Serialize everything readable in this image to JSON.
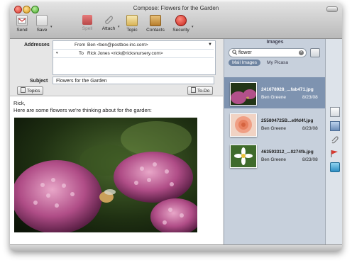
{
  "window": {
    "title": "Compose: Flowers for the Garden"
  },
  "toolbar": {
    "send": "Send",
    "save": "Save",
    "spell": "Spell",
    "attach": "Attach",
    "topic": "Topic",
    "contacts": "Contacts",
    "security": "Security"
  },
  "header": {
    "addresses_label": "Addresses",
    "from_label": "From",
    "from_value": "Ben <ben@postbox-inc.com>",
    "to_label": "To",
    "to_value": "Rick Jones <rick@ricksnursery.com>",
    "subject_label": "Subject",
    "subject_value": "Flowers for the Garden",
    "topics_button": "Topics",
    "todo_button": "To-Do"
  },
  "message": {
    "greeting": "Rick,",
    "line1": "Here are some flowers we're thinking about for the garden:"
  },
  "images_panel": {
    "title": "Images",
    "search_value": "flower",
    "tabs": [
      "Mail Images",
      "My Picasa"
    ],
    "items": [
      {
        "filename": "241678928_...fab471.jpg",
        "author": "Ben Greene",
        "date": "8/23/08"
      },
      {
        "filename": "255804725B...e9fd4f.jpg",
        "author": "Ben Greene",
        "date": "8/23/08"
      },
      {
        "filename": "463593312_...0274fb.jpg",
        "author": "Ben Greene",
        "date": "8/23/08"
      }
    ]
  },
  "colors": {
    "selection": "#7e93b0",
    "panel": "#c7d0dc",
    "close": "#e0443e",
    "minimize": "#dea123",
    "zoom": "#58b23b"
  }
}
